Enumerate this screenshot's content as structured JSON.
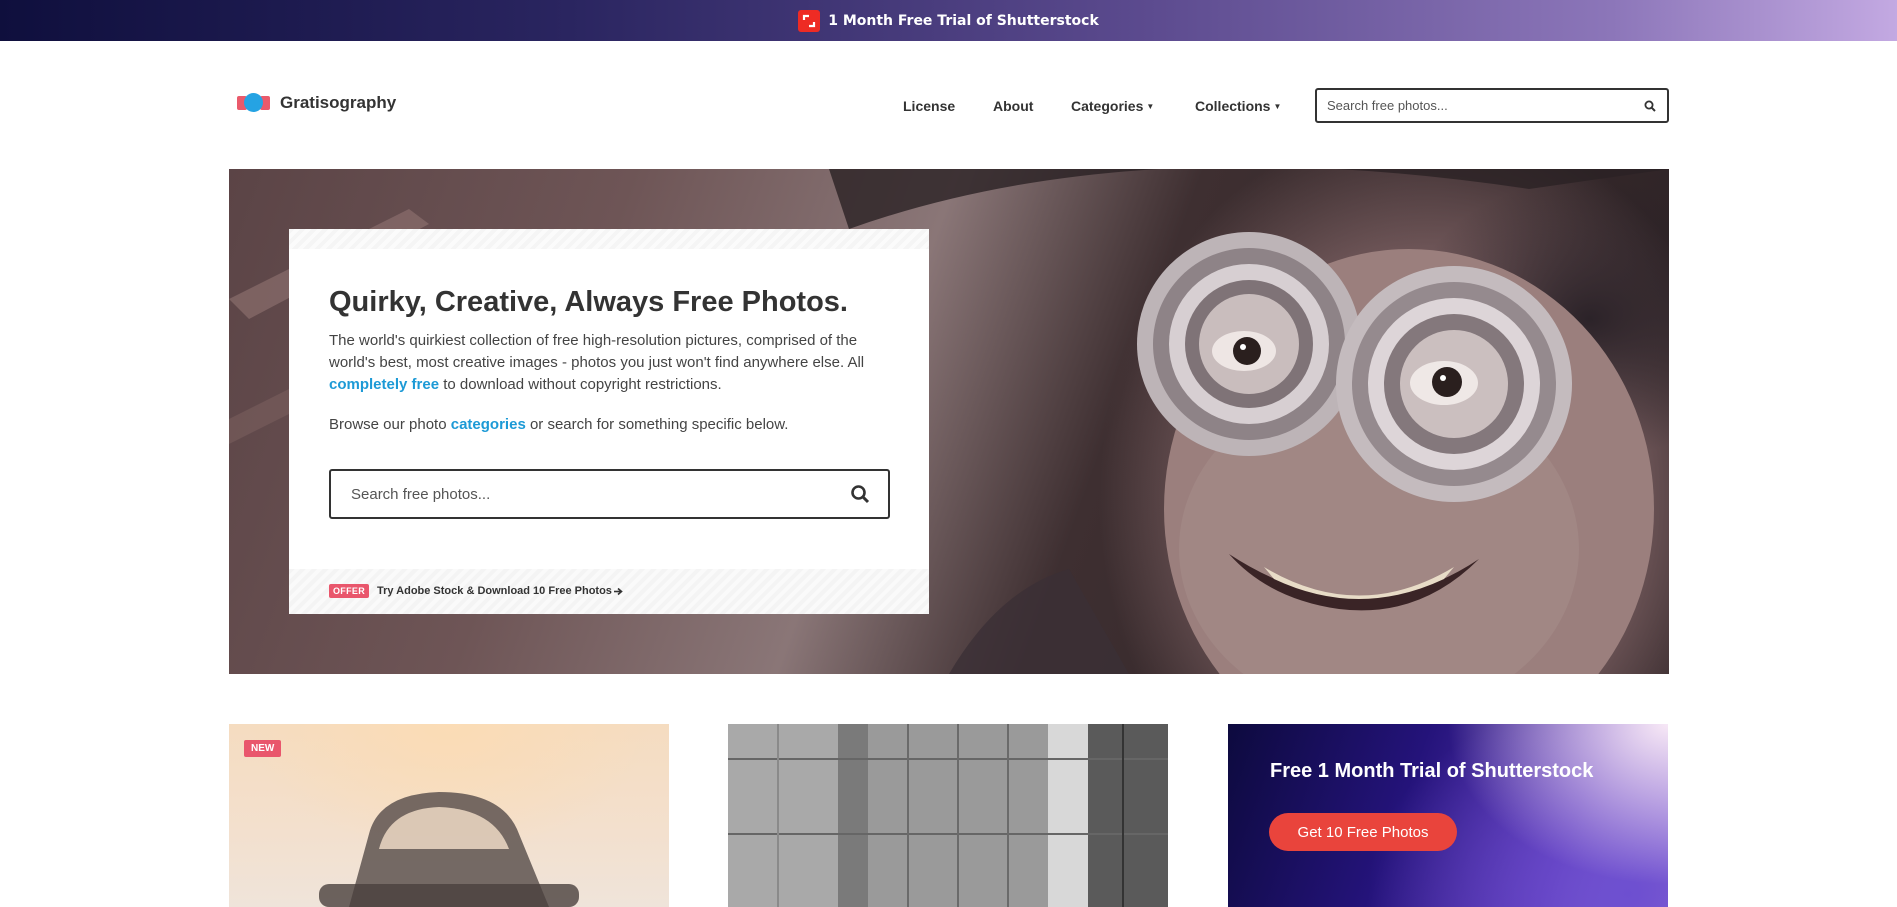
{
  "promo_bar": {
    "text": "1 Month Free Trial of Shutterstock",
    "logo_icon": "shutterstock-logo-icon",
    "logo_color": "#ee2b24"
  },
  "header": {
    "brand_name": "Gratisography",
    "nav": {
      "license": "License",
      "about": "About",
      "categories": "Categories",
      "collections": "Collections"
    },
    "search_placeholder": "Search free photos..."
  },
  "hero": {
    "title": "Quirky, Creative, Always Free Photos.",
    "desc_before": "The world's quirkiest collection of free high-resolution pictures, comprised of the world's best, most creative images - photos you just won't find anywhere else. All ",
    "desc_link": "completely free",
    "desc_after": " to download without copyright restrictions.",
    "browse_before": "Browse our photo ",
    "browse_link": "categories",
    "browse_after": " or search for something specific below.",
    "search_placeholder": "Search free photos...",
    "offer_badge": "OFFER",
    "offer_text": "Try Adobe Stock & Download 10 Free Photos",
    "link_color": "#1d9ad6",
    "badge_color": "#e9566c"
  },
  "cards": {
    "car": {
      "badge": "NEW"
    },
    "shutterstock": {
      "title": "Free 1 Month Trial of Shutterstock",
      "button": "Get 10 Free Photos",
      "button_color": "#e9443c"
    }
  }
}
